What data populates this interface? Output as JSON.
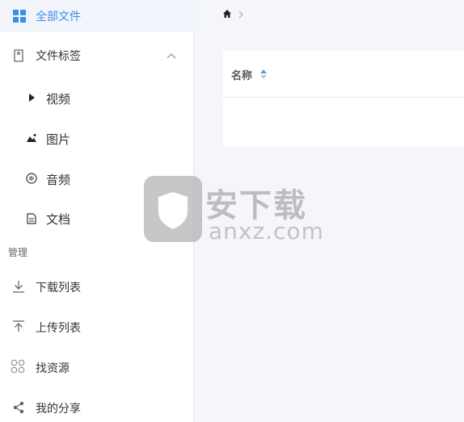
{
  "sidebar": {
    "all_files": "全部文件",
    "file_tags": "文件标签",
    "tags": [
      {
        "label": "视频",
        "icon": "play-icon"
      },
      {
        "label": "图片",
        "icon": "image-icon"
      },
      {
        "label": "音频",
        "icon": "audio-icon"
      },
      {
        "label": "文档",
        "icon": "document-icon"
      }
    ],
    "section_manage": "管理",
    "manage": [
      {
        "label": "下载列表",
        "icon": "download-icon"
      },
      {
        "label": "上传列表",
        "icon": "upload-icon"
      },
      {
        "label": "找资源",
        "icon": "find-resource-icon"
      },
      {
        "label": "我的分享",
        "icon": "share-icon"
      }
    ]
  },
  "main": {
    "breadcrumb_home": "home-icon",
    "table": {
      "col_name": "名称"
    }
  },
  "watermark": {
    "title": "安下载",
    "domain": "anxz.com"
  },
  "colors": {
    "accent": "#3b8fe6",
    "active_bg": "#f2f6fc",
    "page_bg": "#f5f6fa"
  }
}
